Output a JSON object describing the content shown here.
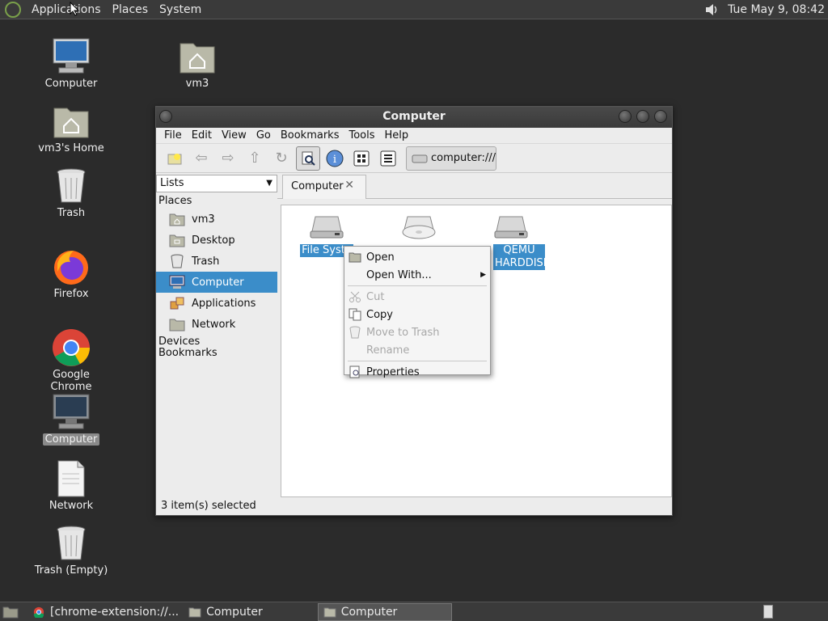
{
  "top_panel": {
    "menus": [
      "Applications",
      "Places",
      "System"
    ],
    "clock": "Tue May  9, 08:42"
  },
  "desktop": {
    "icons": [
      {
        "label": "Computer",
        "icon": "computer-icon"
      },
      {
        "label": "vm3",
        "icon": "home-folder-icon"
      },
      {
        "label": "vm3's Home",
        "icon": "home-folder-icon"
      },
      {
        "label": "Trash",
        "icon": "trash-icon"
      },
      {
        "label": "Firefox",
        "icon": "firefox-icon"
      },
      {
        "label": "Google Chrome",
        "icon": "chrome-icon"
      },
      {
        "label": "Computer",
        "icon": "computer-icon"
      },
      {
        "label": "Network",
        "icon": "document-icon"
      },
      {
        "label": "Trash (Empty)",
        "icon": "trash-icon"
      }
    ]
  },
  "window": {
    "title": "Computer",
    "menubar": [
      "File",
      "Edit",
      "View",
      "Go",
      "Bookmarks",
      "Tools",
      "Help"
    ],
    "location": "computer:///",
    "sidebar": {
      "selector": "Lists",
      "places_label": "Places",
      "items": [
        "vm3",
        "Desktop",
        "Trash",
        "Computer",
        "Applications",
        "Network"
      ],
      "devices_label": "Devices",
      "bookmarks_label": "Bookmarks"
    },
    "tab": "Computer",
    "files": [
      "File Syste",
      "QEMU HARDDISK"
    ],
    "status": "3 item(s) selected"
  },
  "context_menu": {
    "items": [
      "Open",
      "Open With...",
      "Cut",
      "Copy",
      "Move to Trash",
      "Rename",
      "Properties"
    ]
  },
  "taskbar": {
    "tasks": [
      "[chrome-extension://...",
      "Computer",
      "Computer"
    ]
  },
  "colors": {
    "selection": "#3b8dc9",
    "panel": "#3a3a3a",
    "desktop": "#2b2b2b"
  }
}
